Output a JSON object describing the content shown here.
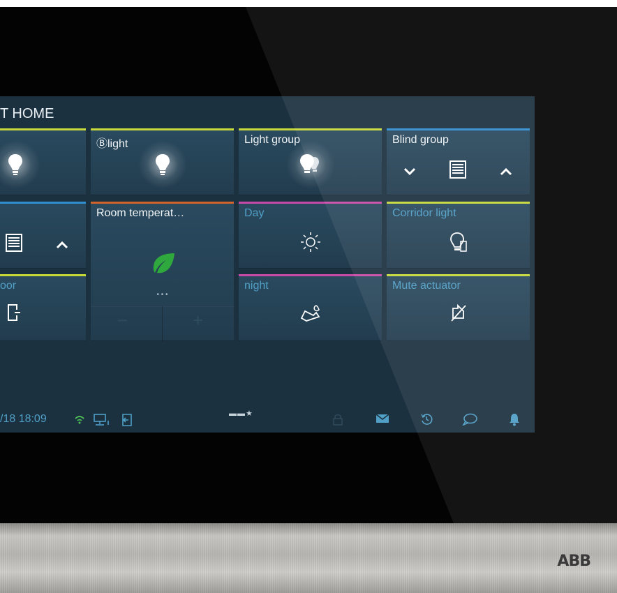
{
  "header": {
    "title": "T HOME"
  },
  "tiles": {
    "r1c1": {
      "label": ""
    },
    "r1c2": {
      "label": "Ⓑlight"
    },
    "r1c3": {
      "label": "Light group"
    },
    "r1c4": {
      "label": "Blind group"
    },
    "r2c1": {
      "label": ""
    },
    "r2c2": {
      "label": "Room temperat…"
    },
    "r2c3": {
      "label": "Day"
    },
    "r2c4": {
      "label": "Corridor light"
    },
    "r3c1": {
      "label": "oor"
    },
    "r3c3": {
      "label": "night"
    },
    "r3c4": {
      "label": "Mute actuator"
    }
  },
  "thermostat": {
    "minus": "−",
    "plus": "+",
    "dots": "• • •"
  },
  "status_bar": {
    "datetime": "/18  18:09",
    "page_indicator": "▬▬★"
  },
  "colors": {
    "yellow": "#c8d93a",
    "blue": "#2f8fd0",
    "orange": "#d0642a",
    "magenta": "#c84aa8",
    "accent_text": "#4f9fc7",
    "leaf_green": "#2fa83e"
  },
  "icons": [
    "bulb-icon",
    "bulbs-icon",
    "chevron-down-icon",
    "blind-icon",
    "chevron-up-icon",
    "leaf-icon",
    "sun-icon",
    "corridor-light-icon",
    "door-icon",
    "moon-bed-icon",
    "mute-icon",
    "wifi-icon",
    "network-icon",
    "exit-icon",
    "lock-icon",
    "mail-icon",
    "history-icon",
    "chat-icon",
    "bell-icon"
  ],
  "brand": {
    "logo": "ABB"
  }
}
